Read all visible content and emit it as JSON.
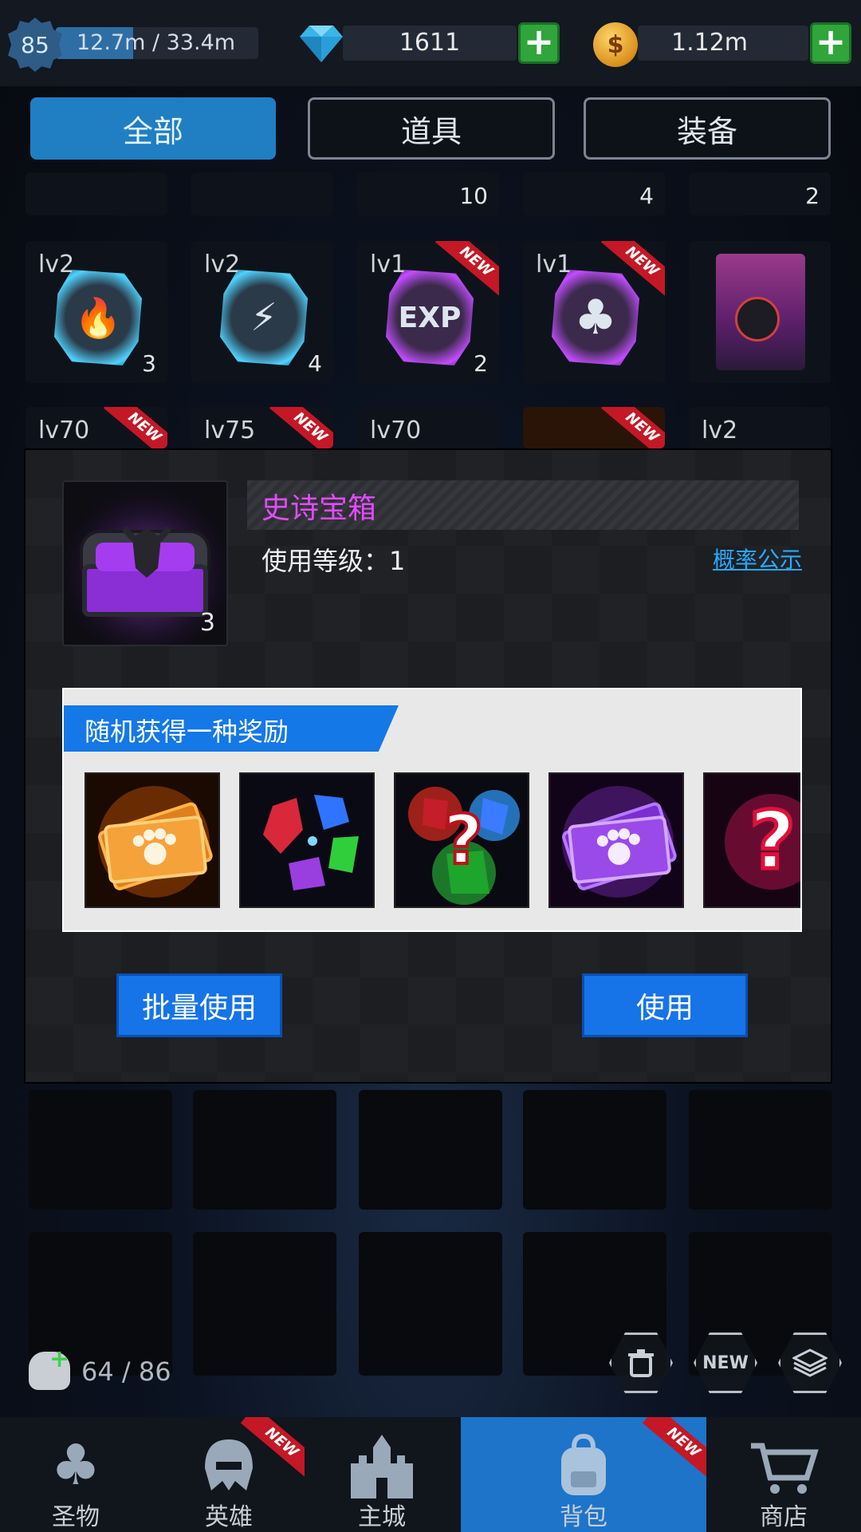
{
  "topbar": {
    "level": "85",
    "xp_text": "12.7m / 33.4m",
    "xp_progress": 0.38,
    "gems": "1611",
    "gold": "1.12m",
    "plus_label": "+"
  },
  "tabs": [
    {
      "label": "全部",
      "active": true
    },
    {
      "label": "道具",
      "active": false
    },
    {
      "label": "装备",
      "active": false
    }
  ],
  "grid_row0": [
    {
      "count": ""
    },
    {
      "count": ""
    },
    {
      "count": "10"
    },
    {
      "count": "4"
    },
    {
      "count": "2"
    }
  ],
  "grid_row1": [
    {
      "level": "lv2",
      "count": "3",
      "symbol": "🔥",
      "color": "cyan"
    },
    {
      "level": "lv2",
      "count": "4",
      "symbol": "⚡",
      "color": "cyan"
    },
    {
      "level": "lv1",
      "count": "2",
      "symbol": "EXP",
      "color": "purple",
      "new": "NEW"
    },
    {
      "level": "lv1",
      "count": "",
      "symbol": "♣",
      "color": "purple",
      "new": "NEW"
    },
    {
      "level": "",
      "count": "",
      "symbol": "",
      "color": "pack"
    }
  ],
  "grid_row2": [
    {
      "level": "lv70",
      "new": "NEW"
    },
    {
      "level": "lv75",
      "new": "NEW"
    },
    {
      "level": "lv70"
    },
    {
      "level": "",
      "new": "NEW"
    },
    {
      "level": "lv2"
    }
  ],
  "modal": {
    "item_name": "史诗宝箱",
    "item_count": "3",
    "use_level": "使用等级：1",
    "probability_link": "概率公示",
    "reward_title": "随机获得一种奖励",
    "rewards": [
      "orange-paw-ticket",
      "gem-bundle",
      "random-gem",
      "purple-paw-ticket",
      "random-item"
    ],
    "batch_use": "批量使用",
    "use": "使用"
  },
  "bag": {
    "capacity": "64 / 86",
    "new_tool": "NEW"
  },
  "navbar": [
    {
      "label": "圣物",
      "icon": "clover-icon",
      "active": false
    },
    {
      "label": "英雄",
      "icon": "helmet-icon",
      "active": false,
      "new": "NEW"
    },
    {
      "label": "主城",
      "icon": "castle-icon",
      "active": false
    },
    {
      "label": "背包",
      "icon": "backpack-icon",
      "active": true,
      "new": "NEW"
    },
    {
      "label": "商店",
      "icon": "cart-icon",
      "active": false
    }
  ],
  "colors": {
    "accent_blue": "#1674e8",
    "epic_purple": "#e24bff",
    "link_blue": "#29a8ff",
    "new_red": "#c41826",
    "plus_green": "#2fa53a"
  }
}
